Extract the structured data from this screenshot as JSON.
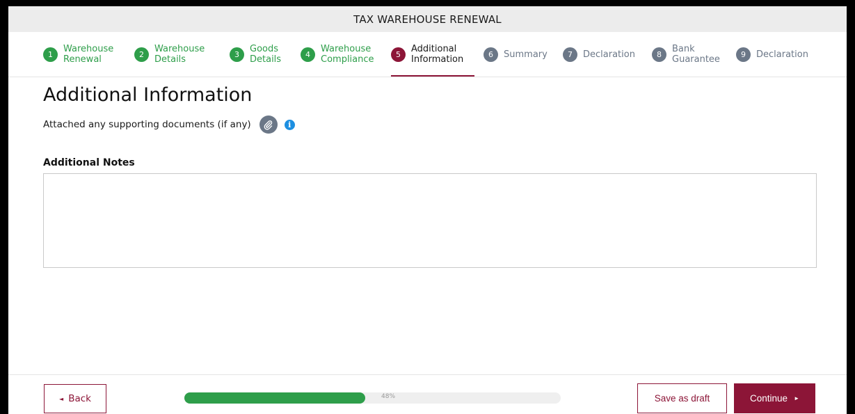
{
  "title": "TAX WAREHOUSE  RENEWAL",
  "steps": [
    {
      "num": "1",
      "label": "Warehouse\nRenewal",
      "state": "done"
    },
    {
      "num": "2",
      "label": "Warehouse\nDetails",
      "state": "done"
    },
    {
      "num": "3",
      "label": "Goods\nDetails",
      "state": "done"
    },
    {
      "num": "4",
      "label": "Warehouse\nCompliance",
      "state": "done"
    },
    {
      "num": "5",
      "label": "Additional\nInformation",
      "state": "current"
    },
    {
      "num": "6",
      "label": "Summary",
      "state": "future"
    },
    {
      "num": "7",
      "label": "Declaration",
      "state": "future"
    },
    {
      "num": "8",
      "label": "Bank\nGuarantee",
      "state": "future"
    },
    {
      "num": "9",
      "label": "Declaration",
      "state": "future"
    }
  ],
  "main": {
    "heading": "Additional Information",
    "attach_label": "Attached any supporting documents (if any)",
    "info_glyph": "i",
    "notes_label": "Additional Notes",
    "notes_value": ""
  },
  "footer": {
    "back_label": "Back",
    "back_arrow": "◄",
    "progress_percent": 48,
    "progress_text": "48%",
    "save_draft_label": "Save as draft",
    "continue_label": "Continue",
    "continue_arrow": "►"
  },
  "colors": {
    "accent": "#8c1537",
    "done_green": "#2e9e4a",
    "future_gray": "#6b7787",
    "info_blue": "#1d8fe1"
  },
  "icons": {
    "attach": "paperclip-icon",
    "info": "info-icon"
  }
}
